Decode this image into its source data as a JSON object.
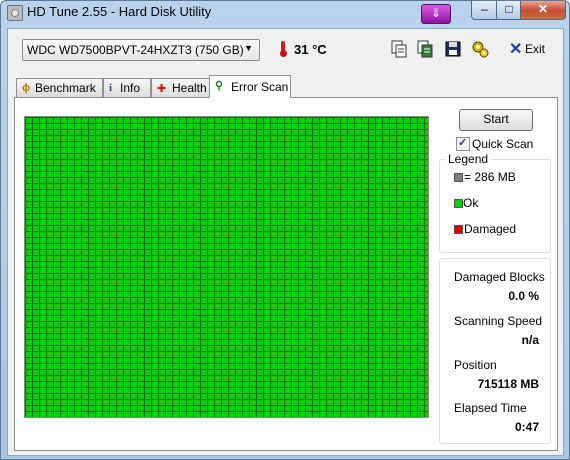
{
  "window": {
    "title": "HD Tune 2.55 - Hard Disk Utility",
    "pin_glyph": "⇓",
    "minimize_glyph": "–",
    "maximize_glyph": "□",
    "close_glyph": "✕"
  },
  "toolbar": {
    "drive": "WDC WD7500BPVT-24HXZT3 (750 GB)",
    "temperature": "31 °C",
    "exit_label": "Exit",
    "icons": [
      "copy-icon",
      "copy-all-icon",
      "save-icon",
      "options-icon",
      "exit-icon",
      "thermometer-icon"
    ]
  },
  "tabs": [
    {
      "label": "Benchmark",
      "icon": "benchmark-icon",
      "glyph": "ϕ"
    },
    {
      "label": "Info",
      "icon": "info-icon",
      "glyph": "i"
    },
    {
      "label": "Health",
      "icon": "health-icon",
      "glyph": "✚"
    },
    {
      "label": "Error Scan",
      "icon": "magnifier-icon",
      "glyph": "⚲"
    }
  ],
  "active_tab": "Error Scan",
  "scan": {
    "start_label": "Start",
    "quick_scan_label": "Quick Scan",
    "quick_scan_checked": true,
    "block_status": "ok",
    "legend": {
      "title": "Legend",
      "items": [
        {
          "label": "= 286 MB",
          "color": "#808080"
        },
        {
          "label": "Ok",
          "color": "#00d000"
        },
        {
          "label": "Damaged",
          "color": "#e00000"
        }
      ]
    },
    "stats": {
      "damaged_blocks_label": "Damaged Blocks",
      "damaged_blocks_value": "0.0 %",
      "scanning_speed_label": "Scanning Speed",
      "scanning_speed_value": "n/a",
      "position_label": "Position",
      "position_value": "715118 MB",
      "elapsed_time_label": "Elapsed Time",
      "elapsed_time_value": "0:47"
    }
  }
}
